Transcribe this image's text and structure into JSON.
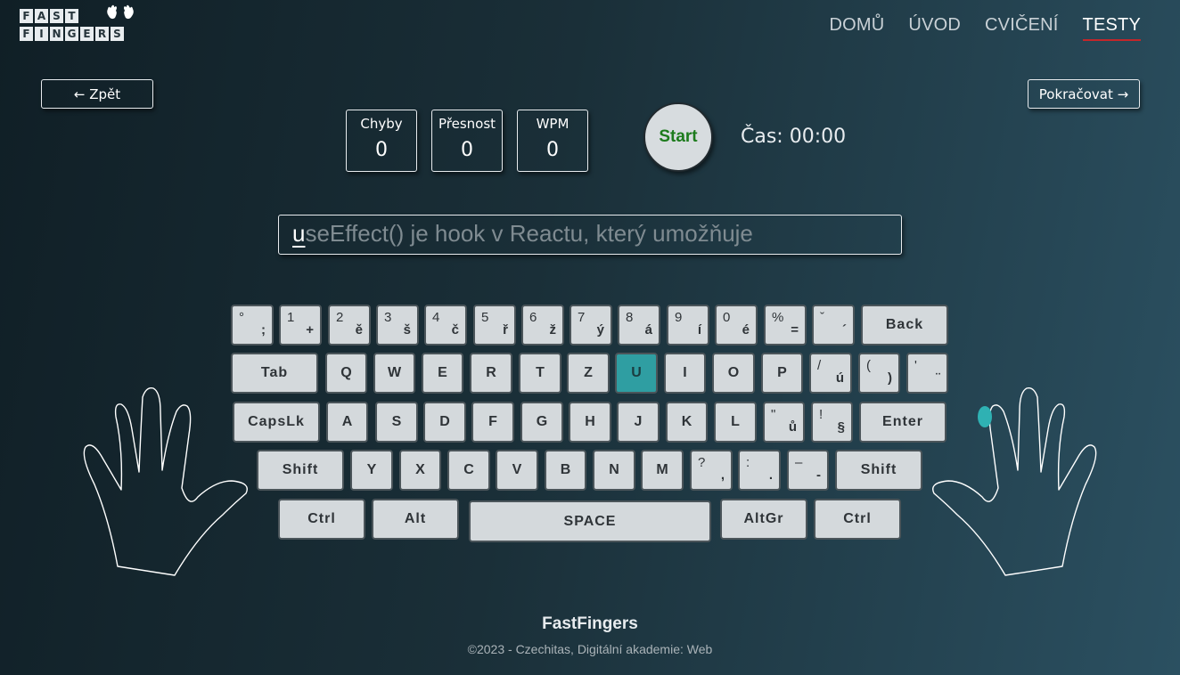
{
  "logo": {
    "row1": [
      "F",
      "A",
      "S",
      "T"
    ],
    "row2": [
      "F",
      "I",
      "N",
      "G",
      "E",
      "R",
      "S"
    ]
  },
  "nav": {
    "items": [
      {
        "label": "DOMŮ"
      },
      {
        "label": "ÚVOD"
      },
      {
        "label": "CVIČENÍ"
      },
      {
        "label": "TESTY",
        "active": true
      }
    ]
  },
  "buttons": {
    "back": "← Zpět",
    "next": "Pokračovat →",
    "start": "Start"
  },
  "stats": {
    "errors": {
      "label": "Chyby",
      "value": "0"
    },
    "accuracy": {
      "label": "Přesnost",
      "value": "0"
    },
    "wpm": {
      "label": "WPM",
      "value": "0"
    }
  },
  "timer": "Čas: 00:00",
  "typing": {
    "current": "u",
    "remaining": "seEffect() je hook v Reactu, který umožňuje"
  },
  "keyboard": {
    "highlight_color": "#2f9ea2",
    "active_key": "U",
    "row1": [
      {
        "top": "°",
        "bottom": ";"
      },
      {
        "top": "1",
        "bottom": "+"
      },
      {
        "top": "2",
        "bottom": "ě"
      },
      {
        "top": "3",
        "bottom": "š"
      },
      {
        "top": "4",
        "bottom": "č"
      },
      {
        "top": "5",
        "bottom": "ř"
      },
      {
        "top": "6",
        "bottom": "ž"
      },
      {
        "top": "7",
        "bottom": "ý"
      },
      {
        "top": "8",
        "bottom": "á"
      },
      {
        "top": "9",
        "bottom": "í"
      },
      {
        "top": "0",
        "bottom": "é"
      },
      {
        "top": "%",
        "bottom": "="
      },
      {
        "top": "ˇ",
        "bottom": "´"
      },
      {
        "label": "Back"
      }
    ],
    "row2": [
      {
        "label": "Tab"
      },
      {
        "label": "Q"
      },
      {
        "label": "W"
      },
      {
        "label": "E"
      },
      {
        "label": "R"
      },
      {
        "label": "T"
      },
      {
        "label": "Z"
      },
      {
        "label": "U"
      },
      {
        "label": "I"
      },
      {
        "label": "O"
      },
      {
        "label": "P"
      },
      {
        "top": "/",
        "bottom": "ú"
      },
      {
        "top": "(",
        "bottom": ")"
      },
      {
        "top": "'",
        "bottom": "¨"
      }
    ],
    "row3": [
      {
        "label": "CapsLk"
      },
      {
        "label": "A"
      },
      {
        "label": "S"
      },
      {
        "label": "D"
      },
      {
        "label": "F"
      },
      {
        "label": "G"
      },
      {
        "label": "H"
      },
      {
        "label": "J"
      },
      {
        "label": "K"
      },
      {
        "label": "L"
      },
      {
        "top": "\"",
        "bottom": "ů"
      },
      {
        "top": "!",
        "bottom": "§"
      },
      {
        "label": "Enter"
      }
    ],
    "row4": [
      {
        "label": "Shift"
      },
      {
        "label": "Y"
      },
      {
        "label": "X"
      },
      {
        "label": "C"
      },
      {
        "label": "V"
      },
      {
        "label": "B"
      },
      {
        "label": "N"
      },
      {
        "label": "M"
      },
      {
        "top": "?",
        "bottom": ","
      },
      {
        "top": ":",
        "bottom": "."
      },
      {
        "top": "–",
        "bottom": "-"
      },
      {
        "label": "Shift"
      }
    ],
    "row5": [
      {
        "label": "Ctrl"
      },
      {
        "label": "Alt"
      },
      {
        "label": "SPACE"
      },
      {
        "label": "AltGr"
      },
      {
        "label": "Ctrl"
      }
    ]
  },
  "footer": {
    "title": "FastFingers",
    "copyright": "©2023 - Czechitas, Digitální akademie: Web"
  }
}
